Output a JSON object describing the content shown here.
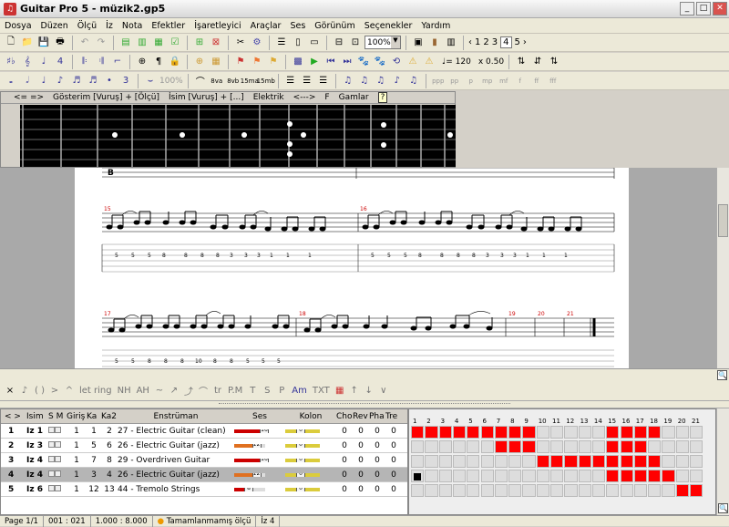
{
  "window": {
    "title": "Guitar Pro 5 - müzik2.gp5"
  },
  "menu": [
    "Dosya",
    "Düzen",
    "Ölçü",
    "İz",
    "Nota",
    "Efektler",
    "İşaretleyici",
    "Araçlar",
    "Ses",
    "Görünüm",
    "Seçenekler",
    "Yardım"
  ],
  "toolbar1": {
    "zoom": "100%",
    "pages": [
      "1",
      "2",
      "3",
      "4",
      "5"
    ],
    "current_page": "4"
  },
  "toolbar2": {
    "tempo": "♩= 120",
    "speed": "x 0.50"
  },
  "toolbar3": {
    "zoom_label": "100%"
  },
  "fretboard_bar": {
    "show": "Gösterim [Vuruş] + [Ölçü]",
    "name": "İsim [Vuruş] + [...]",
    "instrument": "Elektrik",
    "range": "<--->",
    "key": "F",
    "scales": "Gamlar",
    "help": "?",
    "nav": "<= =>"
  },
  "score": {
    "section": "B",
    "measures_row1": [
      "15",
      "16"
    ],
    "measures_row2": [
      "17",
      "18",
      "19",
      "20",
      "21"
    ],
    "tab_row1": "5 — 5 — 5 — 8 — 8 — 8 — 8 — 3 — 3 — 3 — 1 — 1 — 1",
    "tab_row2": "5 — 5 — 8 — 8 — 8 — 10 — 8 — 8 — 5"
  },
  "tracks_header": {
    "nav": "< >",
    "name": "İsim",
    "sm": "S M",
    "port": "Giriş",
    "ch1": "Ka",
    "ch2": "Ka2",
    "instr": "Enstrüman",
    "vol": "Ses",
    "pan": "Kolon",
    "cho": "Cho",
    "rev": "Rev",
    "pha": "Pha",
    "tre": "Tre"
  },
  "tracks": [
    {
      "num": "1",
      "name": "İz 1",
      "port": "1",
      "ch1": "1",
      "ch2": "2",
      "instr": "27 - Electric Guitar (clean)",
      "vol": "16",
      "vol_level": 1.0,
      "pan": "0",
      "cho": "0",
      "rev": "0",
      "pha": "0",
      "tre": "0"
    },
    {
      "num": "2",
      "name": "İz 3",
      "port": "1",
      "ch1": "5",
      "ch2": "6",
      "instr": "26 - Electric Guitar (jazz)",
      "vol": "12",
      "vol_level": 0.75,
      "pan": "0",
      "cho": "0",
      "rev": "0",
      "pha": "0",
      "tre": "0"
    },
    {
      "num": "3",
      "name": "İz 4",
      "port": "1",
      "ch1": "7",
      "ch2": "8",
      "instr": "29 - Overdriven Guitar",
      "vol": "16",
      "vol_level": 1.0,
      "pan": "0",
      "cho": "0",
      "rev": "0",
      "pha": "0",
      "tre": "0"
    },
    {
      "num": "4",
      "name": "İz 4",
      "port": "1",
      "ch1": "3",
      "ch2": "4",
      "instr": "26 - Electric Guitar (jazz)",
      "vol": "12",
      "vol_level": 0.75,
      "pan": "0",
      "cho": "0",
      "rev": "0",
      "pha": "0",
      "tre": "0"
    },
    {
      "num": "5",
      "name": "İz 6",
      "port": "1",
      "ch1": "12",
      "ch2": "13",
      "instr": "44 - Tremolo Strings",
      "vol": "8",
      "vol_level": 0.5,
      "pan": "0",
      "cho": "0",
      "rev": "0",
      "pha": "0",
      "tre": "0"
    }
  ],
  "timeline": {
    "bars": [
      "1",
      "2",
      "3",
      "4",
      "5",
      "6",
      "7",
      "8",
      "9",
      "10",
      "11",
      "12",
      "13",
      "14",
      "15",
      "16",
      "17",
      "18",
      "19",
      "20",
      "21"
    ],
    "filled": [
      [
        1,
        2,
        3,
        4,
        5,
        6,
        7,
        8,
        9,
        15,
        16,
        17,
        18
      ],
      [
        7,
        8,
        9,
        15,
        16,
        17
      ],
      [
        10,
        11,
        12,
        13,
        14,
        15,
        16,
        17,
        18
      ],
      [
        15,
        16,
        17,
        18,
        19
      ],
      [
        20,
        21
      ]
    ]
  },
  "status": {
    "page": "Page 1/1",
    "bar": "001 : 021",
    "time": "1.000 : 8.000",
    "warning": "Tamamlanmamış ölçü",
    "track": "İz 4"
  }
}
